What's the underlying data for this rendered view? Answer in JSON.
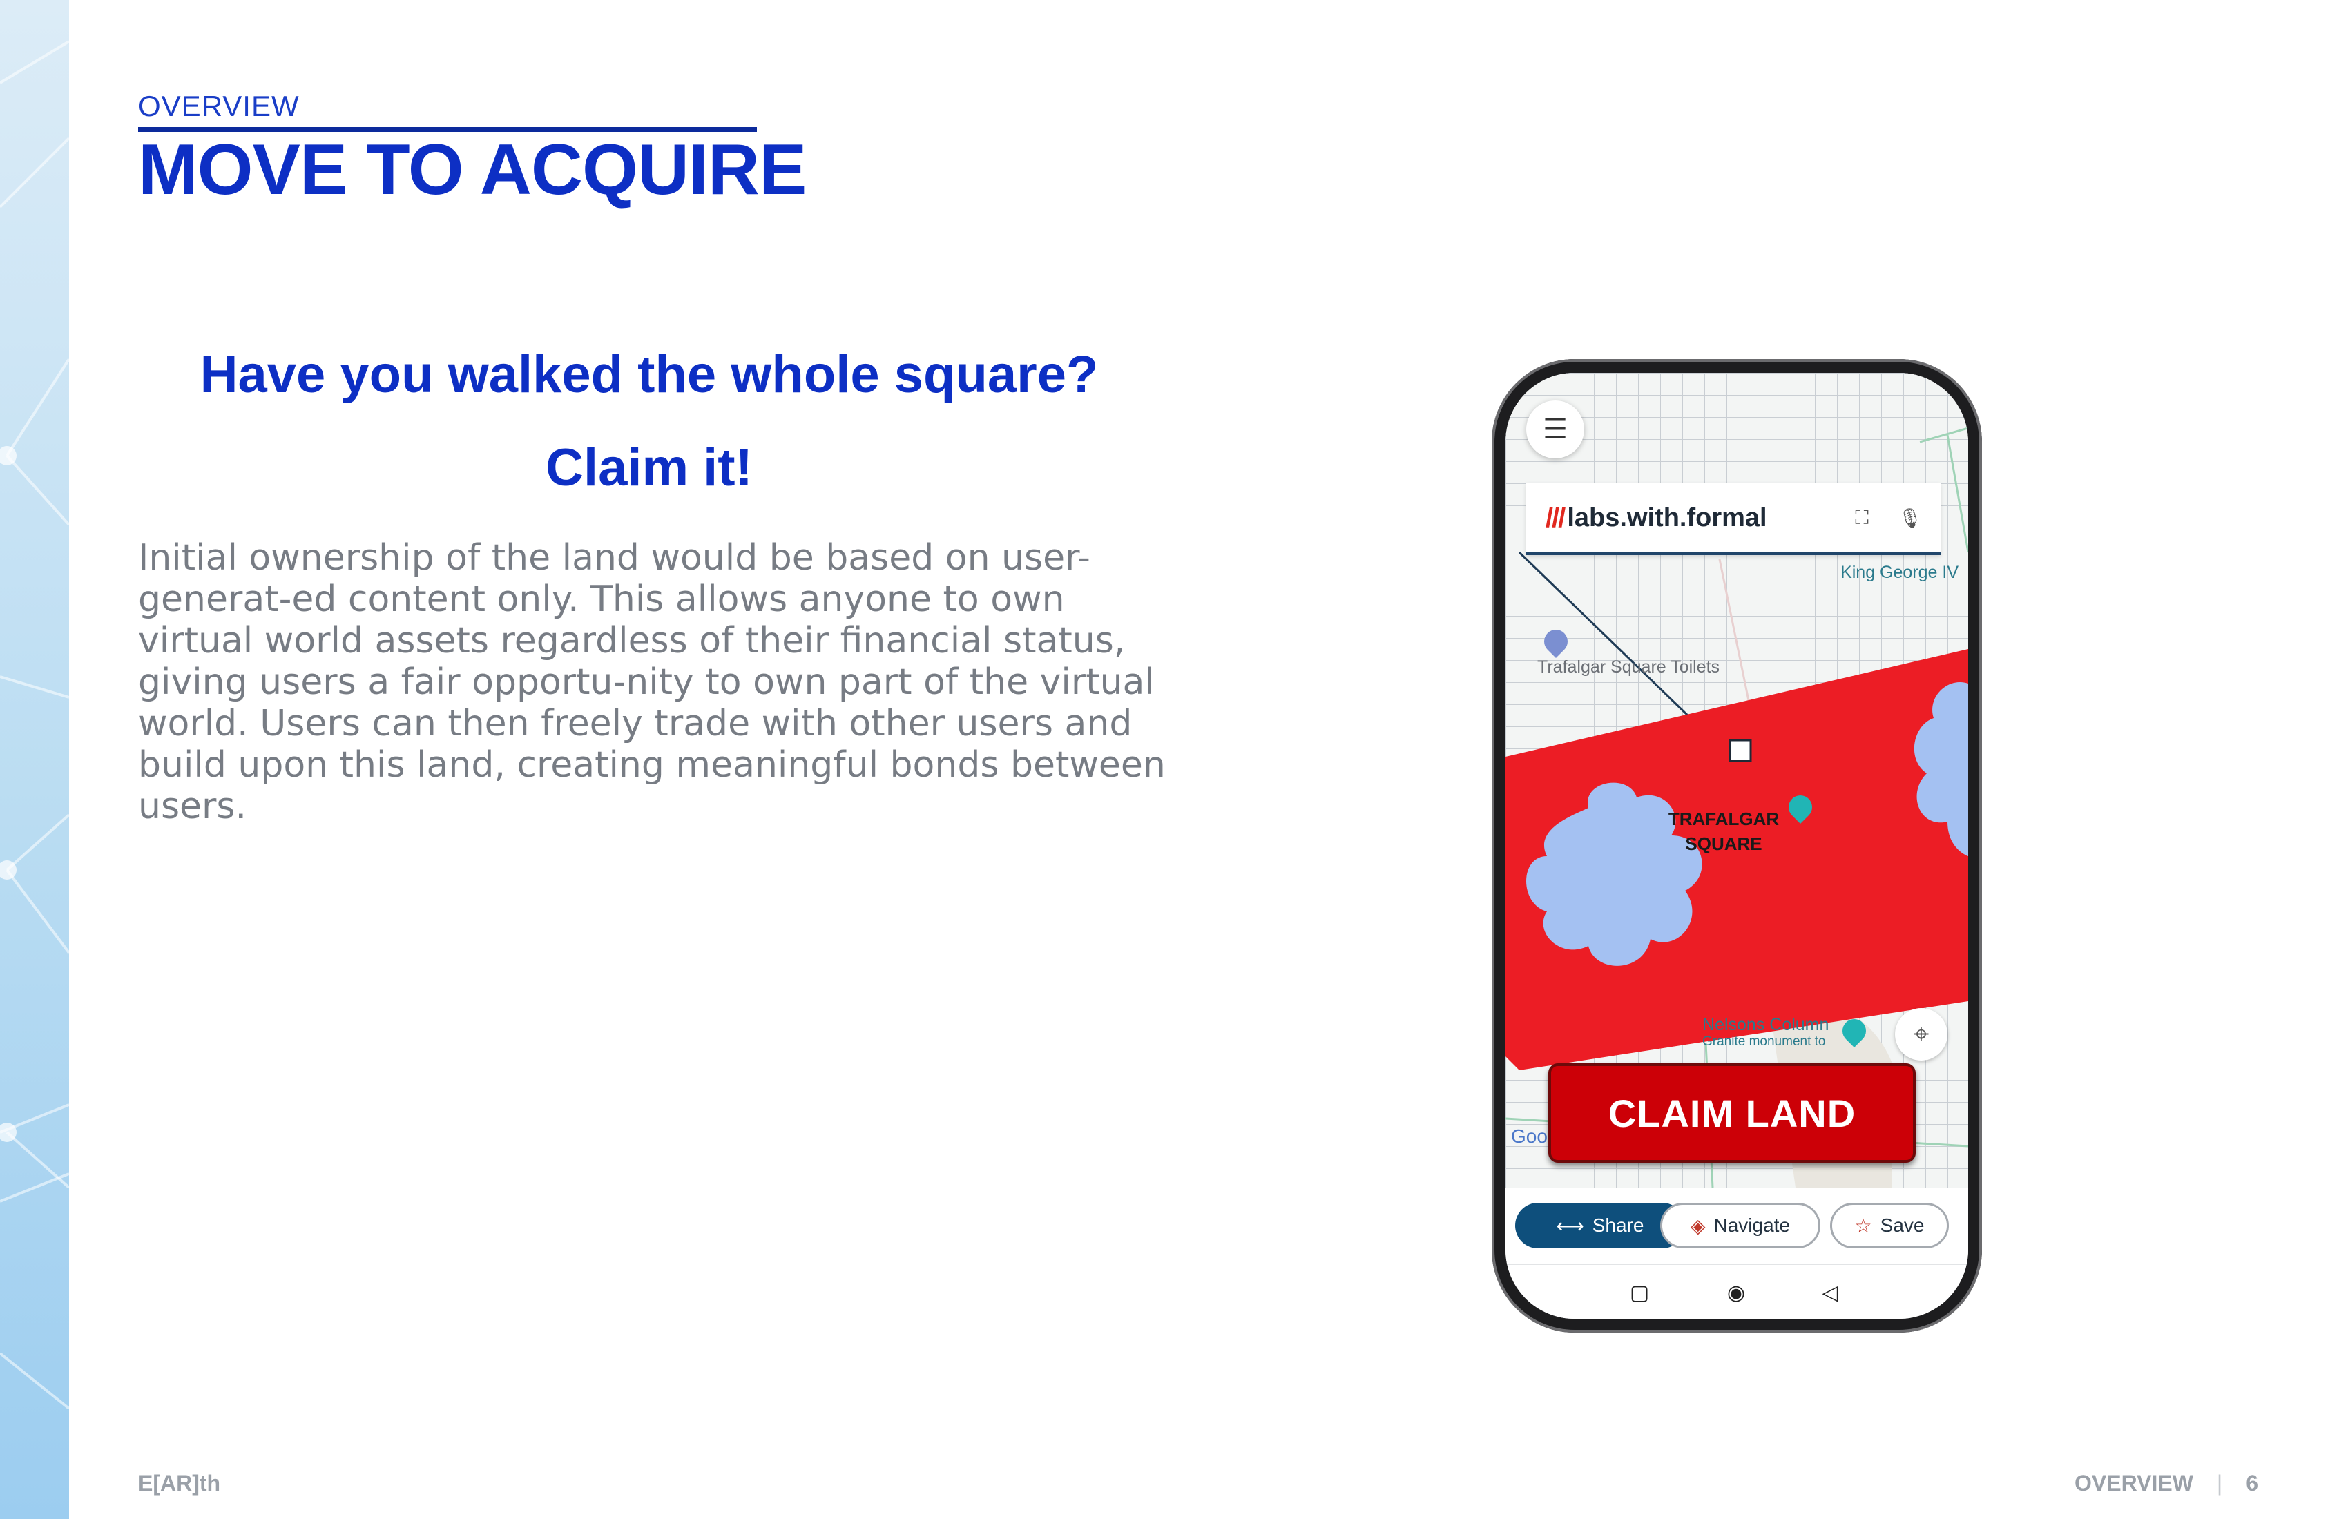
{
  "header": {
    "section_label": "OVERVIEW",
    "title": "MOVE TO ACQUIRE"
  },
  "main": {
    "headline_1": "Have you walked the whole square?",
    "headline_2": "Claim it!",
    "body": "Initial ownership of the land would be based on user-generat-ed content only. This allows anyone to own virtual world assets regardless of their financial status, giving users a fair opportu-nity to own part of the virtual world. Users can then freely trade with other users and build upon this land, creating meaningful bonds between users."
  },
  "phone": {
    "search": {
      "prefix": "///",
      "value": "labs.with.formal"
    },
    "map_labels": {
      "king_george": "King George IV",
      "toilets": "Trafalgar Square Toilets",
      "trafalgar_line1": "TRAFALGAR",
      "trafalgar_line2": "SQUARE",
      "nelson": "Nelsons Column",
      "granite": "Granite monument to",
      "google": "Goo"
    },
    "claim_button": "CLAIM LAND",
    "actions": {
      "share": "Share",
      "navigate": "Navigate",
      "save": "Save"
    },
    "icons": {
      "menu": "hamburger-menu-icon",
      "scan": "scan-icon",
      "mic": "microphone-icon",
      "locate": "my-location-icon",
      "share": "share-icon",
      "navigate": "navigate-icon",
      "save": "star-icon",
      "home": "home-icon",
      "recent": "recents-icon",
      "back": "back-icon"
    },
    "colors": {
      "claim_zone": "#ec1d25",
      "claim_button": "#cc0007",
      "share_button": "#0e4f7c"
    }
  },
  "footer": {
    "brand": "E[AR]th",
    "section": "OVERVIEW",
    "page_number": "6"
  }
}
